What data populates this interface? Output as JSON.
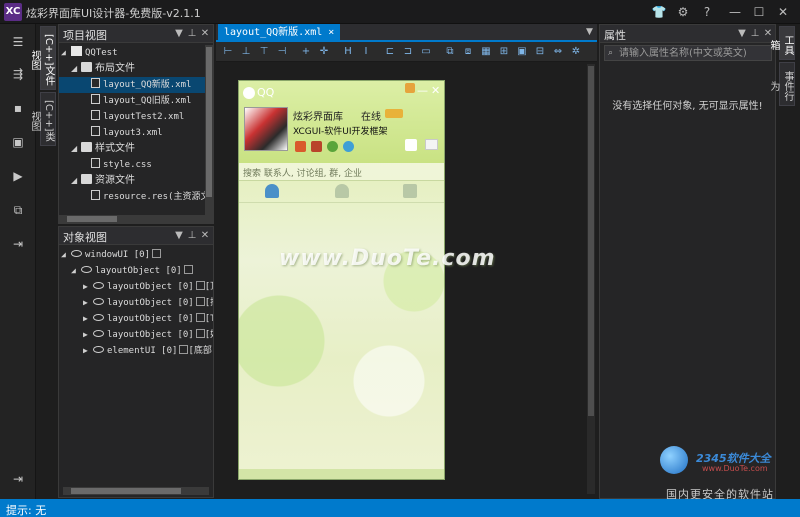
{
  "window": {
    "logo": "XC",
    "title": "炫彩界面库UI设计器-免费版-v2.1.1",
    "controls": [
      "shirt-icon",
      "gear-icon",
      "help-icon",
      "minimize-icon",
      "maximize-icon",
      "close-icon"
    ]
  },
  "vertical_tabs": {
    "left": [
      "[C++]文件视图",
      "[C++]类视图"
    ],
    "right": [
      "工具箱",
      "事件行为"
    ]
  },
  "project_panel": {
    "title": "项目视图",
    "tree": [
      {
        "label": "QQTest",
        "level": 0,
        "type": "project",
        "expanded": true
      },
      {
        "label": "布局文件",
        "level": 1,
        "type": "folder",
        "expanded": true
      },
      {
        "label": "layout_QQ新版.xml",
        "level": 2,
        "type": "file",
        "selected": true
      },
      {
        "label": "layout_QQ旧版.xml",
        "level": 2,
        "type": "file"
      },
      {
        "label": "layoutTest2.xml",
        "level": 2,
        "type": "file"
      },
      {
        "label": "layout3.xml",
        "level": 2,
        "type": "file"
      },
      {
        "label": "样式文件",
        "level": 1,
        "type": "folder",
        "expanded": true
      },
      {
        "label": "style.css",
        "level": 2,
        "type": "file"
      },
      {
        "label": "资源文件",
        "level": 1,
        "type": "folder",
        "expanded": true
      },
      {
        "label": "resource.res(主资源文",
        "level": 2,
        "type": "file"
      }
    ]
  },
  "object_panel": {
    "title": "对象视图",
    "tree": [
      {
        "label": "windowUI [0]",
        "level": 0,
        "expanded": true
      },
      {
        "label": "layoutObject [0]",
        "level": 1,
        "expanded": true
      },
      {
        "label": "layoutObject [0]",
        "suffix": "[顶部",
        "level": 2
      },
      {
        "label": "layoutObject [0]",
        "suffix": "[搜",
        "level": 2
      },
      {
        "label": "layoutObject [0]",
        "suffix": "[Ta",
        "level": 2
      },
      {
        "label": "layoutObject [0]",
        "suffix": "[好",
        "level": 2
      },
      {
        "label": "elementUI [0]",
        "suffix": "[底部]",
        "level": 2
      }
    ]
  },
  "editor": {
    "tab_label": "layout_QQ新版.xml",
    "tab_close": "×"
  },
  "qq_window": {
    "logo_text": "QQ",
    "name": "炫彩界面库",
    "status": "在线",
    "signature": "XCGUI-软件UI开发框架",
    "search_placeholder": "搜索 联系人, 讨论组, 群, 企业"
  },
  "watermark": "www.DuoTe.com",
  "properties_panel": {
    "title": "属性",
    "search_placeholder": "请输入属性名称(中文或英文)",
    "empty_message": "没有选择任何对象, 无可显示属性!"
  },
  "status_bar": {
    "text": "提示: 无"
  },
  "corner_brand": {
    "site": "2345软件大全",
    "url": "www.DuoTe.com",
    "tagline": "国内更安全的软件站"
  },
  "colors": {
    "accent": "#007acc",
    "selection": "#094771",
    "panel_bg": "#252526"
  }
}
